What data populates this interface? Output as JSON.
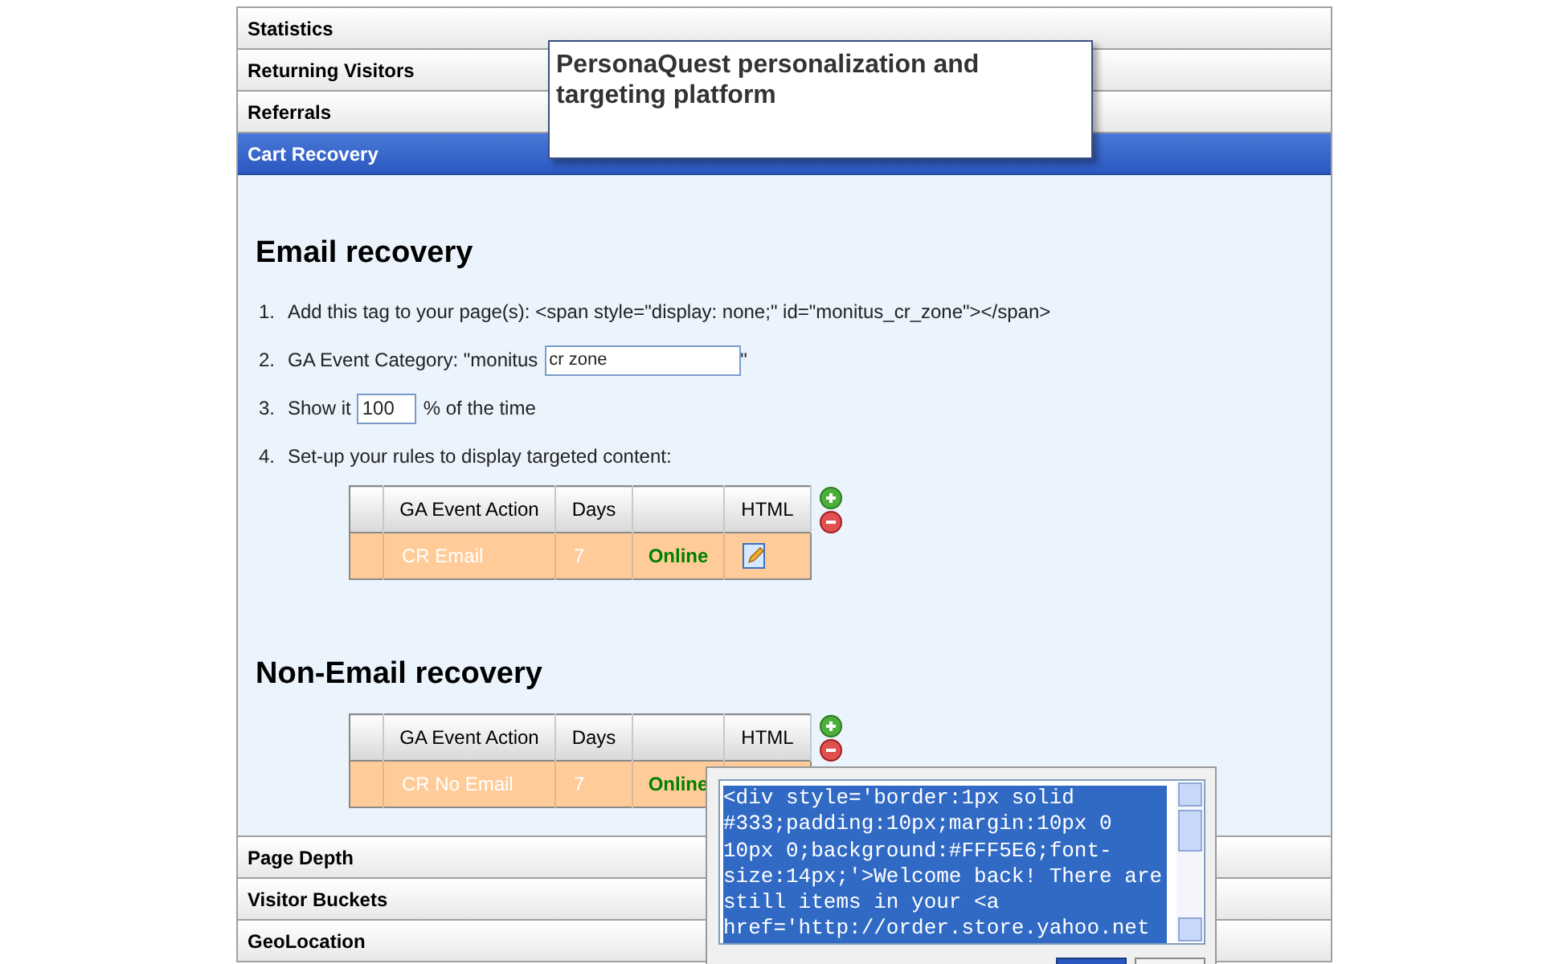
{
  "sections": [
    {
      "title": "Statistics",
      "selected": false
    },
    {
      "title": "Returning Visitors",
      "selected": false
    },
    {
      "title": "Referrals",
      "selected": false
    },
    {
      "title": "Cart Recovery",
      "selected": true
    },
    {
      "title": "Page Depth",
      "selected": false
    },
    {
      "title": "Visitor Buckets",
      "selected": false
    },
    {
      "title": "GeoLocation",
      "selected": false
    }
  ],
  "cart_recovery": {
    "email": {
      "heading": "Email recovery",
      "steps": [
        {
          "kind": "text",
          "number": "1.",
          "text": "Add this tag to your page(s): <span style=\"display: none;\" id=\"monitus_cr_zone\"></span>"
        },
        {
          "kind": "category",
          "number": "2.",
          "before": "GA Event Category: \"monitus",
          "value": "cr zone",
          "after": "\""
        },
        {
          "kind": "percent",
          "number": "3.",
          "before": "Show it",
          "value": "100",
          "after": "% of the time"
        },
        {
          "kind": "text",
          "number": "4.",
          "text": "Set-up your rules to display targeted content:"
        }
      ],
      "table": {
        "columns": [
          "GA Event Action",
          "Days",
          "HTML"
        ],
        "rows": [
          {
            "action": "CR Email",
            "days": "7",
            "status": "Online"
          }
        ]
      }
    },
    "non_email": {
      "heading": "Non-Email recovery",
      "table": {
        "columns": [
          "GA Event Action",
          "Days",
          "HTML"
        ],
        "rows": [
          {
            "action": "CR No Email",
            "days": "7",
            "status": "Online"
          }
        ]
      }
    }
  },
  "tooltip": {
    "text": "PersonaQuest personalization and targeting platform"
  },
  "html_editor": {
    "value": "<div style='border:1px solid #333;padding:10px;margin:10px 0 10px 0;background:#FFF5E6;font-size:14px;'>Welcome back! There are still items in your <a href='http://order.store.yahoo.net"
  }
}
